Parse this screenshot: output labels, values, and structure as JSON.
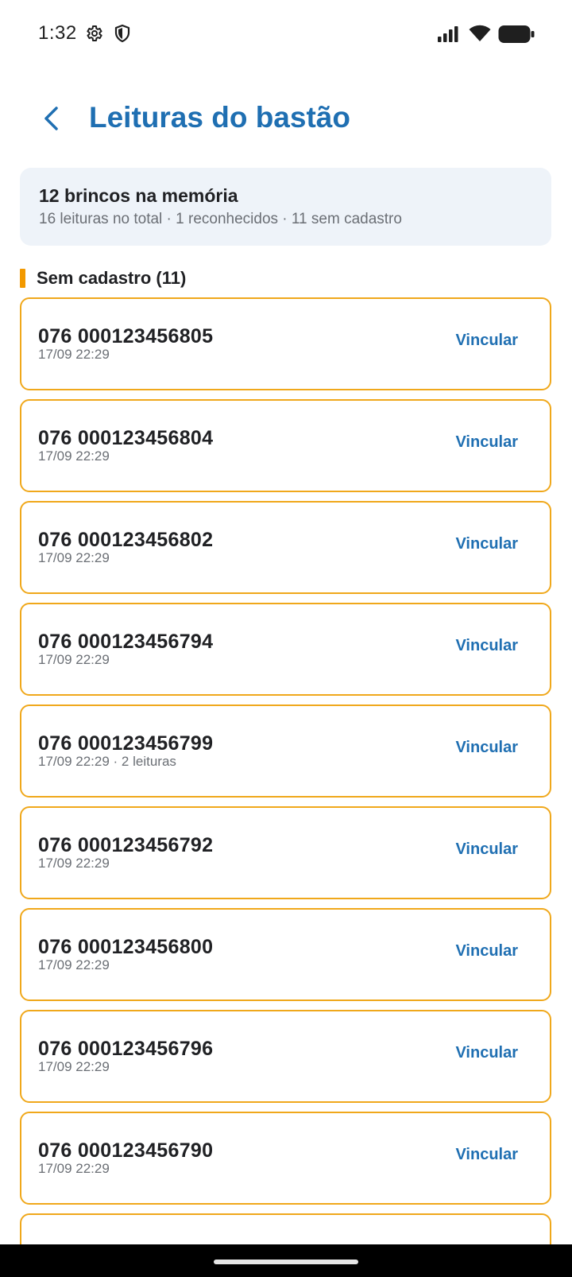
{
  "status_bar": {
    "time": "1:32",
    "left_icons": [
      "settings-gear-icon",
      "shield-icon"
    ],
    "right_icons": [
      "signal-icon",
      "wifi-icon",
      "battery-icon"
    ]
  },
  "header": {
    "back_icon": "chevron-left-icon",
    "title": "Leituras do bastão"
  },
  "summary": {
    "title": "12 brincos na memória",
    "subtitle": "16 leituras no total · 1 reconhecidos · 11 sem cadastro"
  },
  "section": {
    "title": "Sem cadastro (11)",
    "accent_color": "#f29900"
  },
  "colors": {
    "primary": "#1f6fb2",
    "card_border": "#f0a81b",
    "summary_bg": "#eef3f9"
  },
  "tags": [
    {
      "number": "076 000123456805",
      "meta": "17/09 22:29",
      "action": "Vincular"
    },
    {
      "number": "076 000123456804",
      "meta": "17/09 22:29",
      "action": "Vincular"
    },
    {
      "number": "076 000123456802",
      "meta": "17/09 22:29",
      "action": "Vincular"
    },
    {
      "number": "076 000123456794",
      "meta": "17/09 22:29",
      "action": "Vincular"
    },
    {
      "number": "076 000123456799",
      "meta": "17/09 22:29 · 2 leituras",
      "action": "Vincular"
    },
    {
      "number": "076 000123456792",
      "meta": "17/09 22:29",
      "action": "Vincular"
    },
    {
      "number": "076 000123456800",
      "meta": "17/09 22:29",
      "action": "Vincular"
    },
    {
      "number": "076 000123456796",
      "meta": "17/09 22:29",
      "action": "Vincular"
    },
    {
      "number": "076 000123456790",
      "meta": "17/09 22:29",
      "action": "Vincular"
    },
    {
      "number": "",
      "meta": "",
      "action": ""
    }
  ]
}
